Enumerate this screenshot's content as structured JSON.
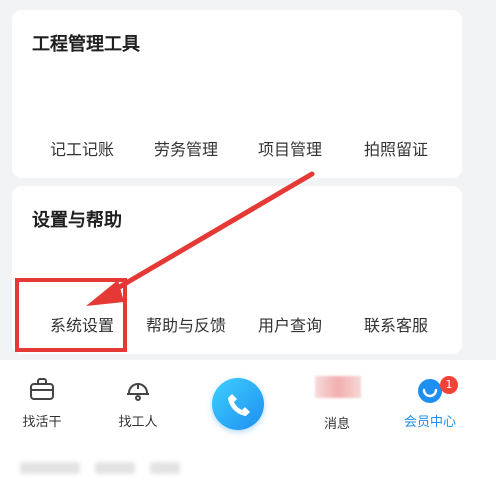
{
  "tools_card": {
    "title": "工程管理工具",
    "items": [
      "记工记账",
      "劳务管理",
      "项目管理",
      "拍照留证"
    ]
  },
  "settings_card": {
    "title": "设置与帮助",
    "items": [
      "系统设置",
      "帮助与反馈",
      "用户查询",
      "联系客服"
    ]
  },
  "tabbar": {
    "tabs": [
      "找活干",
      "找工人",
      "",
      "消息",
      "会员中心"
    ],
    "badge": "1",
    "active_color": "#1e8ef0"
  },
  "annotation": {
    "color": "#e53935"
  }
}
